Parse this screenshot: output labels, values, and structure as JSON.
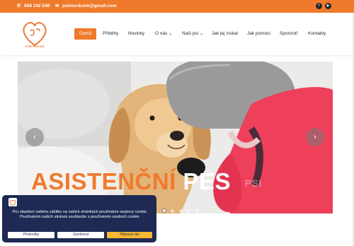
{
  "topbar": {
    "phone": "808 192 548",
    "email": "psimsrdcem@gmail.com",
    "social_icons": [
      "facebook-icon",
      "youtube-icon"
    ]
  },
  "logo": {
    "text": "PSÍM SRDCEM"
  },
  "nav": {
    "items": [
      {
        "label": "Domů",
        "active": true
      },
      {
        "label": "Příběhy"
      },
      {
        "label": "Novinky"
      },
      {
        "label": "O nás",
        "dropdown": true
      },
      {
        "label": "Naši psi",
        "dropdown": true
      },
      {
        "label": "Jak jej získat"
      },
      {
        "label": "Jak pomoci"
      },
      {
        "label": "Sponzoři"
      },
      {
        "label": "Kontakty"
      }
    ]
  },
  "slider": {
    "headline_word1": "ASISTENČNÍ",
    "headline_word2": "PES",
    "headline_word3": "PSI",
    "prev_label": "‹",
    "next_label": "›",
    "slide_count": 5,
    "active_slide": 1
  },
  "cookie": {
    "text": "Pro zlepšení vašeho zážitku na našich stránkách používáme soubory cookie. Používáním našich stránek souhlasíte s používáním souborů cookie.",
    "btn_preferences": "Předvolby",
    "btn_reject": "Zamítnout",
    "btn_accept": "Přijmout vše"
  },
  "colors": {
    "accent": "#f07a2c",
    "cookie_bg": "#1e2a53",
    "accept": "#f7b732"
  }
}
